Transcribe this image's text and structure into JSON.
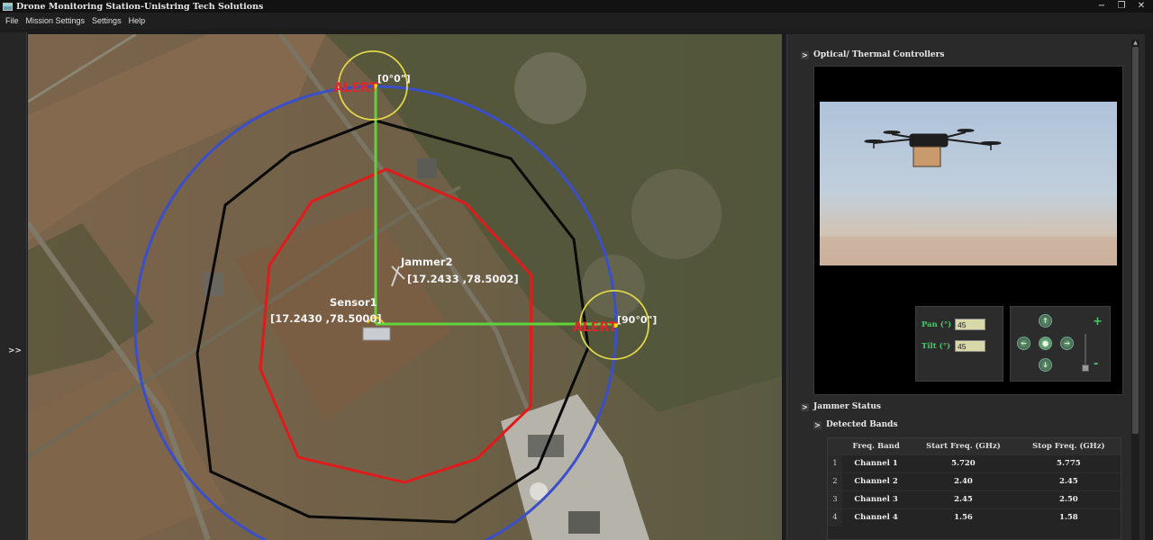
{
  "window": {
    "title": "Drone Monitoring Station-Unistring Tech Solutions",
    "controls": {
      "minimize": "−",
      "restore": "❐",
      "close": "✕"
    }
  },
  "menu": [
    "File",
    "Mission Settings",
    "Settings",
    "Help"
  ],
  "left_strip": {
    "expand_label": ">>"
  },
  "map": {
    "alert_top": "ALERT",
    "alert_right": "ALERT",
    "marker_top": "[0°0\"]",
    "marker_right": "[90°0\"]",
    "jammer_name": "Jammer2",
    "jammer_coords": "[17.2433 ,78.5002]",
    "sensor_name": "Sensor1",
    "sensor_coords": "[17.2430 ,78.5000]",
    "colors": {
      "outer_ring": "#3a4fc8",
      "black_zone": "#0a0a0a",
      "red_zone": "#e01b1b",
      "axis": "#5fd43a",
      "alert_circle": "#e3d84a",
      "alert_text": "#e0262a"
    }
  },
  "optical": {
    "header": "Optical/ Thermal Controllers",
    "pan_label": "Pan  (°)",
    "pan_value": "45",
    "tilt_label": "Tilt  (°)",
    "tilt_value": "45",
    "zoom_plus": "+",
    "zoom_minus": "-"
  },
  "jammer_status": {
    "header": "Jammer Status",
    "detected_header": "Detected Bands",
    "columns": [
      "Freq. Band",
      "Start Freq. (GHz)",
      "Stop Freq. (GHz)"
    ],
    "rows": [
      {
        "idx": "1",
        "band": "Channel 1",
        "start": "5.720",
        "stop": "5.775"
      },
      {
        "idx": "2",
        "band": "Channel 2",
        "start": "2.40",
        "stop": "2.45"
      },
      {
        "idx": "3",
        "band": "Channel 3",
        "start": "2.45",
        "stop": "2.50"
      },
      {
        "idx": "4",
        "band": "Channel 4",
        "start": "1.56",
        "stop": "1.58"
      }
    ]
  }
}
